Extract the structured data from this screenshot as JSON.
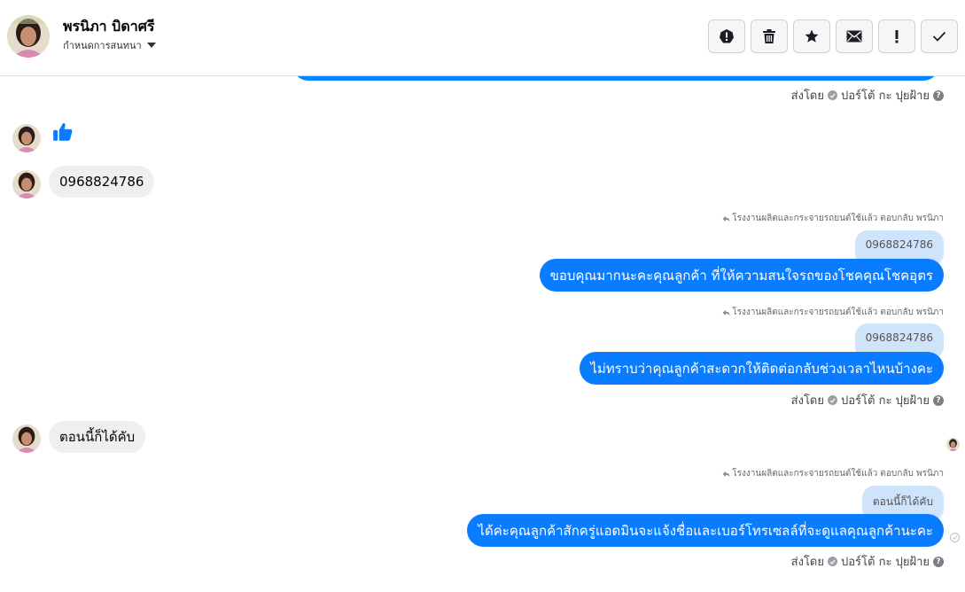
{
  "header": {
    "contact_name": "พรนิภา บิดาศรี",
    "assign_label": "กำหนดการสนทนา",
    "toolbar": {
      "icons": [
        "alert-circle-icon",
        "trash-icon",
        "star-icon",
        "envelope-icon",
        "exclamation-icon",
        "checkmark-icon"
      ]
    }
  },
  "thread": {
    "sent_by_prefix": "ส่งโดย",
    "sent_by_name": "ปอร์โต้ กะ ปุยฝ้าย",
    "help": "?",
    "incoming": [
      {
        "type": "like"
      },
      {
        "type": "text",
        "text": "0968824786"
      },
      {
        "type": "text",
        "text": "ตอนนี้ก็ได้คับ"
      }
    ],
    "replies": [
      {
        "meta": "โรงงานผลิตและกระจายรถยนต์ใช้แล้ว ตอบกลับ พรนิภา",
        "quote": "0968824786",
        "text": "ขอบคุณมากนะคะคุณลูกค้า ที่ให้ความสนใจรถของโชคคุณโชคอุตร"
      },
      {
        "meta": "โรงงานผลิตและกระจายรถยนต์ใช้แล้ว ตอบกลับ พรนิภา",
        "quote": "0968824786",
        "text": "ไม่ทราบว่าคุณลูกค้าสะดวกให้ติดต่อกลับช่วงเวลาไหนบ้างคะ"
      },
      {
        "meta": "โรงงานผลิตและกระจายรถยนต์ใช้แล้ว ตอบกลับ พรนิภา",
        "quote": "ตอนนี้ก็ได้คับ",
        "text": "ได้ค่ะคุณลูกค้าสักครู่แอดมินจะแจ้งชื่อและเบอร์โทรเซลล์ที่จะดูแลคุณลูกค้านะคะ"
      }
    ]
  },
  "colors": {
    "outgoing": "#0a7cff",
    "quote": "#cfe3fb",
    "incoming": "#efefef",
    "like": "#0a7cff"
  }
}
